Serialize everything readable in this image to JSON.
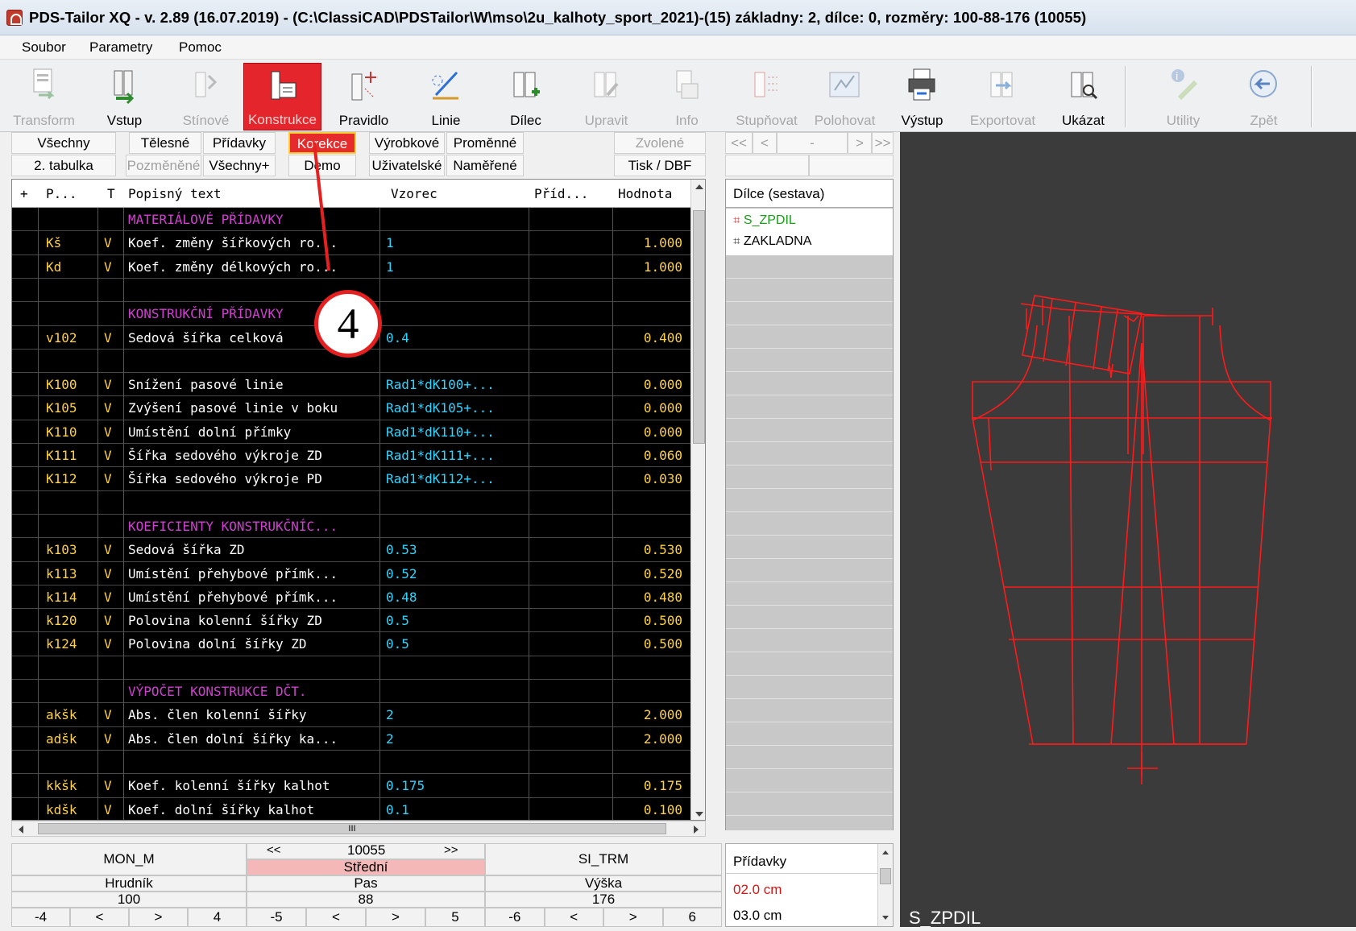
{
  "window": {
    "title": "PDS-Tailor XQ - v. 2.89 (16.07.2019) - (C:\\ClassiCAD\\PDSTailor\\W\\mso\\2u_kalhoty_sport_2021)-(15) základny: 2, dílce: 0, rozměry: 100-88-176 (10055)"
  },
  "menu": [
    "Soubor",
    "Parametry",
    "Pomoc"
  ],
  "toolbar": [
    {
      "label": "Transform",
      "icon": "transform-icon",
      "enabled": false
    },
    {
      "label": "Vstup",
      "icon": "input-icon",
      "enabled": true
    },
    {
      "label": "Stínové",
      "icon": "shadow-icon",
      "enabled": false
    },
    {
      "label": "Konstrukce",
      "icon": "construction-icon",
      "enabled": true,
      "active": true
    },
    {
      "label": "Pravidlo",
      "icon": "rule-icon",
      "enabled": true
    },
    {
      "label": "Linie",
      "icon": "line-icon",
      "enabled": true
    },
    {
      "label": "Dílec",
      "icon": "piece-icon",
      "enabled": true
    },
    {
      "label": "Upravit",
      "icon": "edit-icon",
      "enabled": false
    },
    {
      "label": "Info",
      "icon": "info-icon",
      "enabled": false
    },
    {
      "label": "Stupňovat",
      "icon": "grade-icon",
      "enabled": false
    },
    {
      "label": "Polohovat",
      "icon": "position-icon",
      "enabled": false
    },
    {
      "label": "Výstup",
      "icon": "printer-icon",
      "enabled": true
    },
    {
      "label": "Exportovat",
      "icon": "export-icon",
      "enabled": false
    },
    {
      "label": "Ukázat",
      "icon": "show-icon",
      "enabled": true
    },
    {
      "label": "Utility",
      "icon": "utility-icon",
      "enabled": false
    },
    {
      "label": "Zpět",
      "icon": "back-icon",
      "enabled": false
    }
  ],
  "filters": {
    "row1": [
      "Všechny",
      "Tělesné",
      "Přídavky",
      "Korekce",
      "Výrobkové",
      "Proměnné",
      "Zvolené"
    ],
    "row2": [
      "2. tabulka",
      "Pozměněné",
      "Všechny+",
      "Demo",
      "Uživatelské",
      "Naměřené",
      "Tisk / DBF"
    ],
    "active": "Korekce"
  },
  "nav": {
    "first": "<<",
    "prev": "<",
    "dash": "-",
    "next": ">",
    "last": ">>"
  },
  "grid": {
    "columns": [
      "+",
      "P...",
      "T",
      "Popisný text",
      "Vzorec",
      "Příd...",
      "Hodnota"
    ],
    "rows": [
      {
        "code": "",
        "type": "",
        "text": "MATERIÁLOVÉ PŘÍDAVKY",
        "formula": "",
        "value": "",
        "section": true
      },
      {
        "code": "Kš",
        "type": "V",
        "text": "Koef. změny šířkových ro...",
        "formula": "1",
        "value": "1.000"
      },
      {
        "code": "Kd",
        "type": "V",
        "text": "Koef. změny délkových ro...",
        "formula": "1",
        "value": "1.000"
      },
      {
        "code": "",
        "type": "",
        "text": "",
        "formula": "",
        "value": ""
      },
      {
        "code": "",
        "type": "",
        "text": "KONSTRUKČNÍ PŘÍDAVKY",
        "formula": "",
        "value": "",
        "section": true
      },
      {
        "code": "v102",
        "type": "V",
        "text": "Sedová šířka celková",
        "formula": "0.4",
        "value": "0.400"
      },
      {
        "code": "",
        "type": "",
        "text": "",
        "formula": "",
        "value": ""
      },
      {
        "code": "K100",
        "type": "V",
        "text": "Snížení pasové linie",
        "formula": "Rad1*dK100+...",
        "value": "0.000"
      },
      {
        "code": "K105",
        "type": "V",
        "text": "Zvýšení pasové linie v boku",
        "formula": "Rad1*dK105+...",
        "value": "0.000"
      },
      {
        "code": "K110",
        "type": "V",
        "text": "Umístění dolní přímky",
        "formula": "Rad1*dK110+...",
        "value": "0.000"
      },
      {
        "code": "K111",
        "type": "V",
        "text": "Šířka sedového výkroje ZD",
        "formula": "Rad1*dK111+...",
        "value": "0.060"
      },
      {
        "code": "K112",
        "type": "V",
        "text": "Šířka sedového výkroje PD",
        "formula": "Rad1*dK112+...",
        "value": "0.030"
      },
      {
        "code": "",
        "type": "",
        "text": "",
        "formula": "",
        "value": ""
      },
      {
        "code": "",
        "type": "",
        "text": "KOEFICIENTY KONSTRUKČNÍC...",
        "formula": "",
        "value": "",
        "section": true
      },
      {
        "code": "k103",
        "type": "V",
        "text": "Sedová šířka ZD",
        "formula": "0.53",
        "value": "0.530"
      },
      {
        "code": "k113",
        "type": "V",
        "text": "Umístění přehybové přímk...",
        "formula": "0.52",
        "value": "0.520"
      },
      {
        "code": "k114",
        "type": "V",
        "text": "Umístění přehybové přímk...",
        "formula": "0.48",
        "value": "0.480"
      },
      {
        "code": "k120",
        "type": "V",
        "text": "Polovina kolenní šířky ZD",
        "formula": "0.5",
        "value": "0.500"
      },
      {
        "code": "k124",
        "type": "V",
        "text": "Polovina dolní šířky ZD",
        "formula": "0.5",
        "value": "0.500"
      },
      {
        "code": "",
        "type": "",
        "text": "",
        "formula": "",
        "value": ""
      },
      {
        "code": "",
        "type": "",
        "text": "VÝPOČET KONSTRUKCE DČT.",
        "formula": "",
        "value": "",
        "section": true
      },
      {
        "code": "akšk",
        "type": "V",
        "text": "Abs. člen kolenní šířky",
        "formula": "2",
        "value": "2.000"
      },
      {
        "code": "adšk",
        "type": "V",
        "text": "Abs. člen dolní šířky ka...",
        "formula": "2",
        "value": "2.000"
      },
      {
        "code": "",
        "type": "",
        "text": "",
        "formula": "",
        "value": ""
      },
      {
        "code": "kkšk",
        "type": "V",
        "text": "Koef. kolenní šířky kalhot",
        "formula": "0.175",
        "value": "0.175"
      },
      {
        "code": "kdšk",
        "type": "V",
        "text": "Koef. dolní šířky kalhot",
        "formula": "0.1",
        "value": "0.100"
      }
    ]
  },
  "hscroll": {
    "grip": "III"
  },
  "parts": {
    "title": "Dílce (sestava)",
    "items": [
      {
        "name": "S_ZPDIL",
        "color": "#1a9e1a",
        "icon": "piece-icon-red"
      },
      {
        "name": "ZAKLADNA",
        "color": "#000000",
        "icon": "piece-icon-black"
      }
    ]
  },
  "sizes": {
    "left_name": "MON_M",
    "center_code": "10055",
    "center_label": "Střední",
    "right_name": "SI_TRM",
    "prev": "<<",
    "next": ">>",
    "measures": [
      {
        "label": "Hrudník",
        "value": "100",
        "steps": [
          "-4",
          "<",
          ">",
          "4"
        ]
      },
      {
        "label": "Pas",
        "value": "88",
        "steps": [
          "-5",
          "<",
          ">",
          "5"
        ]
      },
      {
        "label": "Výška",
        "value": "176",
        "steps": [
          "-6",
          "<",
          ">",
          "6"
        ]
      }
    ]
  },
  "allowances": {
    "title": "Přídavky",
    "items": [
      {
        "value": "02.0 cm",
        "color": "#e01010"
      },
      {
        "value": "03.0 cm",
        "color": "#000000"
      }
    ]
  },
  "canvas": {
    "label": "S_ZPDIL",
    "stroke": "#ff1a1a",
    "background": "#3b3b3b"
  },
  "annotation": {
    "number": "4",
    "color": "#e52020"
  }
}
